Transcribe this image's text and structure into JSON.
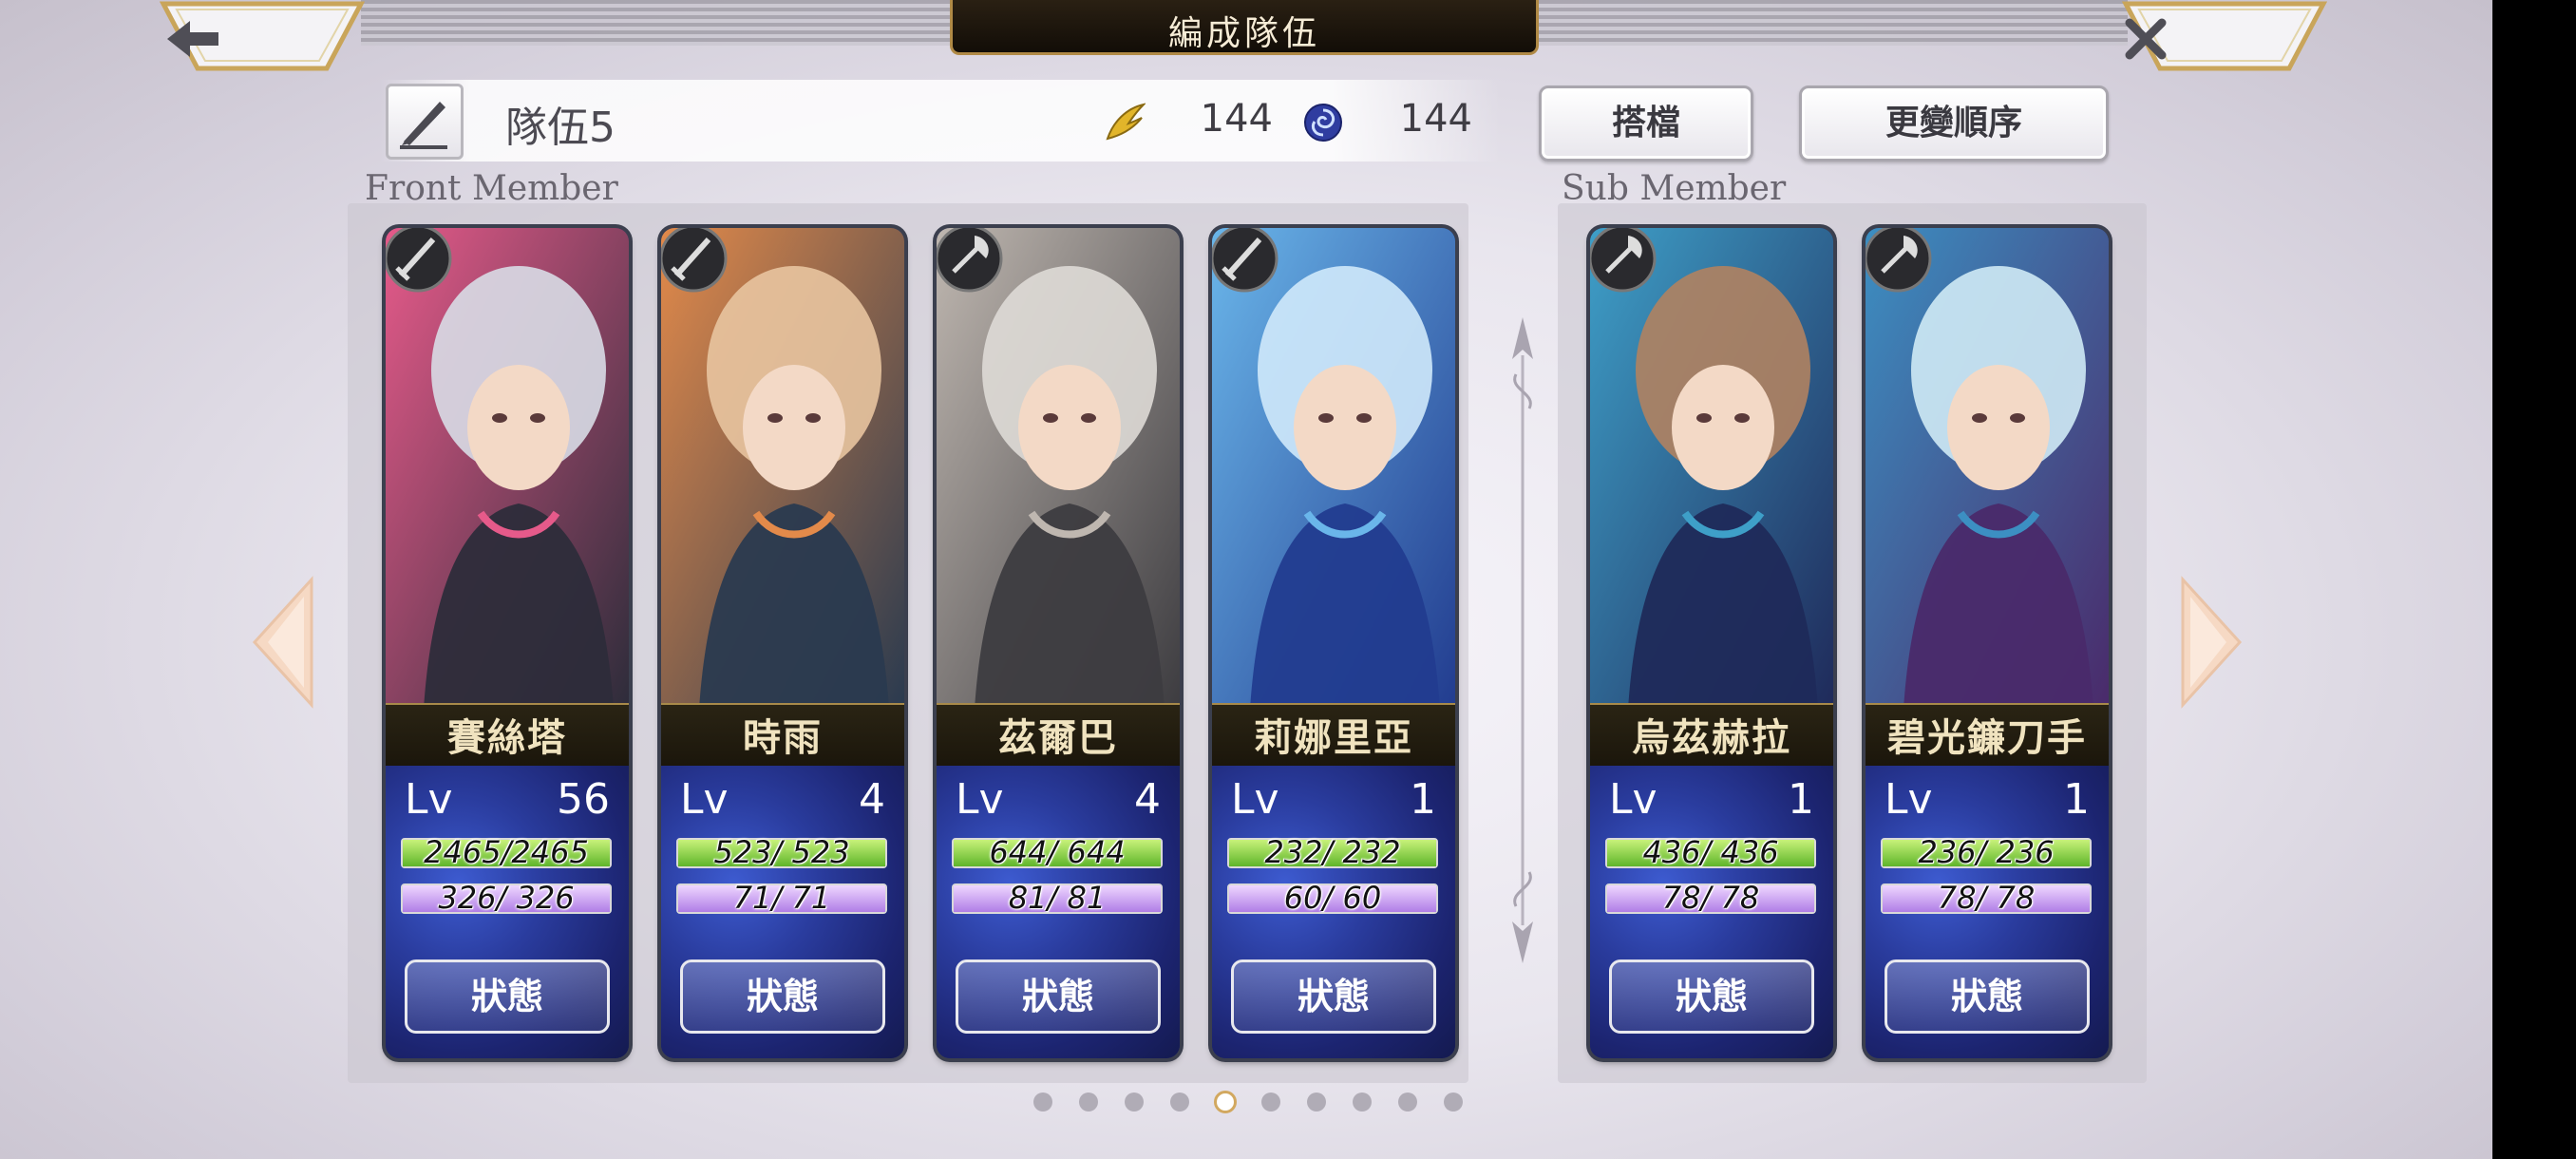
{
  "header": {
    "title": "編成隊伍",
    "back_icon": "back-arrow-icon",
    "close_icon": "close-icon"
  },
  "team": {
    "name": "隊伍5",
    "wing_value": "144",
    "swirl_value": "144"
  },
  "buttons": {
    "partner": "搭檔",
    "reorder": "更變順序"
  },
  "sections": {
    "front": "Front Member",
    "sub": "Sub Member"
  },
  "cards": [
    {
      "name": "賽絲塔",
      "lv_label": "Lv",
      "lv": "56",
      "hp": "2465/2465",
      "sp": "326/ 326",
      "hp_fraction": 1,
      "sp_fraction": 1,
      "weapon": "sword-icon"
    },
    {
      "name": "時雨",
      "lv_label": "Lv",
      "lv": "4",
      "hp": "523/ 523",
      "sp": "71/ 71",
      "hp_fraction": 1,
      "sp_fraction": 1,
      "weapon": "sword-icon"
    },
    {
      "name": "茲爾巴",
      "lv_label": "Lv",
      "lv": "4",
      "hp": "644/ 644",
      "sp": "81/ 81",
      "hp_fraction": 1,
      "sp_fraction": 1,
      "weapon": "axe-icon"
    },
    {
      "name": "莉娜里亞",
      "lv_label": "Lv",
      "lv": "1",
      "hp": "232/ 232",
      "sp": "60/ 60",
      "hp_fraction": 1,
      "sp_fraction": 1,
      "weapon": "sword-icon"
    },
    {
      "name": "烏茲赫拉",
      "lv_label": "Lv",
      "lv": "1",
      "hp": "436/ 436",
      "sp": "78/ 78",
      "hp_fraction": 1,
      "sp_fraction": 1,
      "weapon": "axe-icon"
    },
    {
      "name": "碧光鐮刀手",
      "lv_label": "Lv",
      "lv": "1",
      "hp": "236/ 236",
      "sp": "78/ 78",
      "hp_fraction": 1,
      "sp_fraction": 1,
      "weapon": "axe-icon"
    }
  ],
  "status_label": "狀態",
  "pagination": {
    "total": 10,
    "current": 5
  },
  "colors": {
    "gold": "#c9a55a",
    "hp": "#5fb52a",
    "sp": "#b07ee6",
    "card_blue": "#2a3c9e"
  }
}
